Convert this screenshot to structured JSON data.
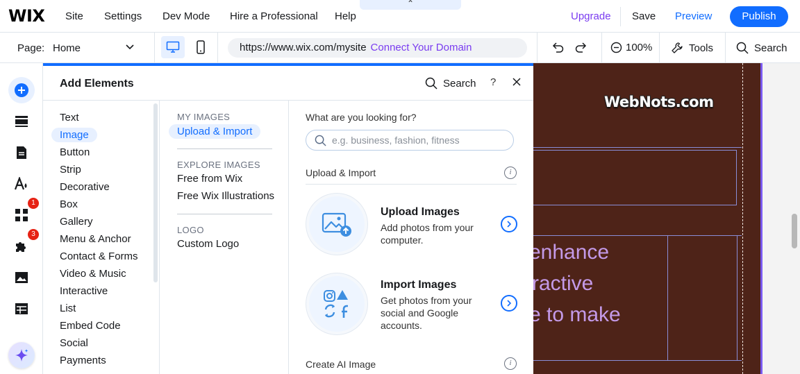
{
  "topbar": {
    "logo": "WIX",
    "nav": [
      "Site",
      "Settings",
      "Dev Mode",
      "Hire a Professional",
      "Help"
    ],
    "upgrade": "Upgrade",
    "save": "Save",
    "preview": "Preview",
    "publish": "Publish",
    "brand_color": "#116dff"
  },
  "secondbar": {
    "page_label": "Page:",
    "page_value": "Home",
    "url": "https://www.wix.com/mysite",
    "connect_domain": "Connect Your Domain",
    "zoom": "100%",
    "tools": "Tools",
    "search": "Search"
  },
  "rail": {
    "badges": [
      "1",
      "3"
    ]
  },
  "panel": {
    "title": "Add Elements",
    "search": "Search",
    "help": "?",
    "categories": [
      "Text",
      "Image",
      "Button",
      "Strip",
      "Decorative",
      "Box",
      "Gallery",
      "Menu & Anchor",
      "Contact & Forms",
      "Video & Music",
      "Interactive",
      "List",
      "Embed Code",
      "Social",
      "Payments"
    ],
    "active_category": "Image",
    "sub": {
      "my_images_head": "MY IMAGES",
      "upload_import": "Upload & Import",
      "explore_head": "EXPLORE IMAGES",
      "free_from_wix": "Free from Wix",
      "free_illustrations": "Free Wix Illustrations",
      "logo_head": "LOGO",
      "custom_logo": "Custom Logo"
    },
    "content": {
      "look_label": "What are you looking for?",
      "search_placeholder": "e.g. business, fashion, fitness",
      "section_upload": "Upload & Import",
      "upload_title": "Upload Images",
      "upload_desc": "Add photos from your computer.",
      "import_title": "Import Images",
      "import_desc": "Get photos from your social and Google accounts.",
      "section_ai": "Create AI Image"
    }
  },
  "canvas": {
    "watermark": "WebNots.com",
    "line1": "enhance",
    "line2": "ractive",
    "line3": "e to make",
    "bg_color": "#4e2318",
    "text_color": "#c49ae8"
  }
}
